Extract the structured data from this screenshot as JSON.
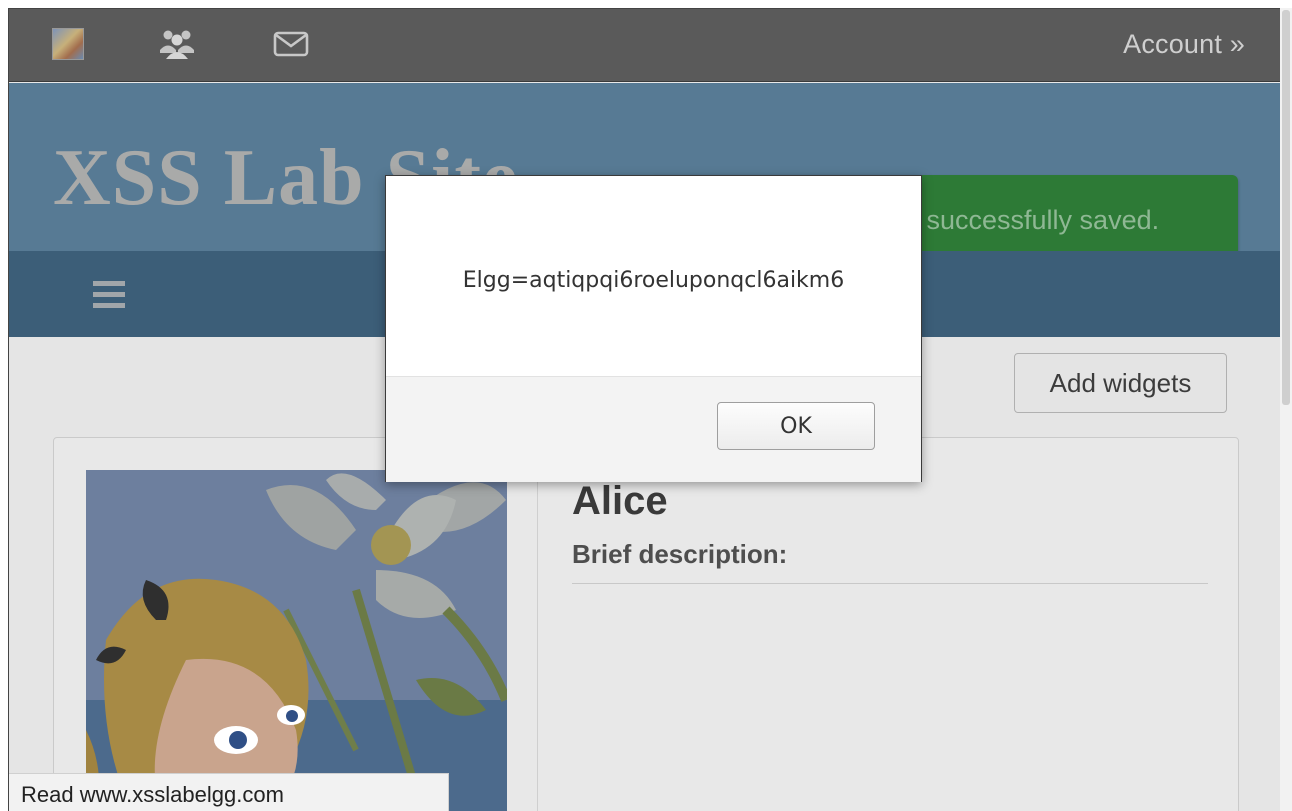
{
  "topbar": {
    "icons": {
      "avatar": "user-avatar-icon",
      "friends": "friends-icon",
      "messages": "envelope-icon"
    },
    "account_label": "Account »"
  },
  "header": {
    "site_title": "XSS Lab Site",
    "flash_message": "Your profile was successfully saved.",
    "flash_color": "#2d7a36"
  },
  "nav": {
    "menu_icon": "hamburger-icon"
  },
  "profile": {
    "add_widgets_label": "Add widgets",
    "name": "Alice",
    "brief_label": "Brief description:"
  },
  "dialog": {
    "message": "Elgg=aqtiqpqi6roeluponqcl6aikm6",
    "ok_label": "OK"
  },
  "statusbar": {
    "text": "Read www.xsslabelgg.com"
  },
  "colors": {
    "topbar": "#5a5a5a",
    "header": "#577a94",
    "navbar": "#3c5e78"
  }
}
